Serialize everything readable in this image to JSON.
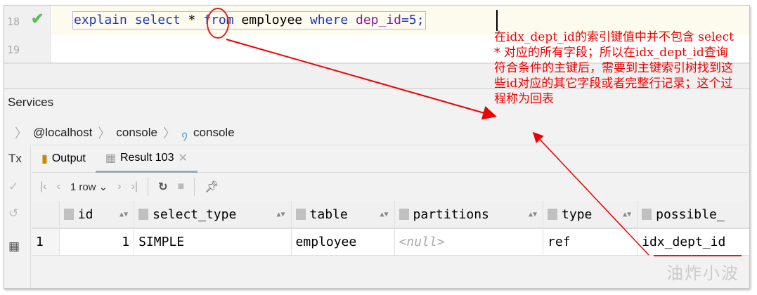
{
  "editor": {
    "lines": [
      {
        "number": "18",
        "code": {
          "kw1": "explain select",
          "star": " * ",
          "kw2": "from",
          "tbl": " employee ",
          "kw3": "where",
          "fld": " dep_id",
          "rest": "=5;"
        }
      },
      {
        "number": "19"
      }
    ]
  },
  "services": {
    "title": "Services",
    "breadcrumb": [
      "@localhost",
      "console",
      "console"
    ]
  },
  "left_strip": {
    "tx": "Tx"
  },
  "tabs": [
    {
      "label": "Output",
      "icon": "output-icon"
    },
    {
      "label": "Result 103",
      "icon": "table-icon",
      "active": true
    }
  ],
  "toolbar": {
    "rows": "1 row"
  },
  "grid": {
    "columns": [
      "id",
      "select_type",
      "table",
      "partitions",
      "type",
      "possible_"
    ],
    "rows": [
      {
        "num": "1",
        "cells": [
          "1",
          "SIMPLE",
          "employee",
          "<null>",
          "ref",
          "idx_dept_id"
        ]
      }
    ]
  },
  "annotation": {
    "text": "在idx_dept_id的索引键值中并不包含 select * 对应的所有字段；所以在idx_dept_id查询符合条件的主键后，需要到主键索引树找到这些id对应的其它字段或者完整行记录；这个过程称为回表",
    "color": "#e00000"
  },
  "watermark": "油炸小波"
}
